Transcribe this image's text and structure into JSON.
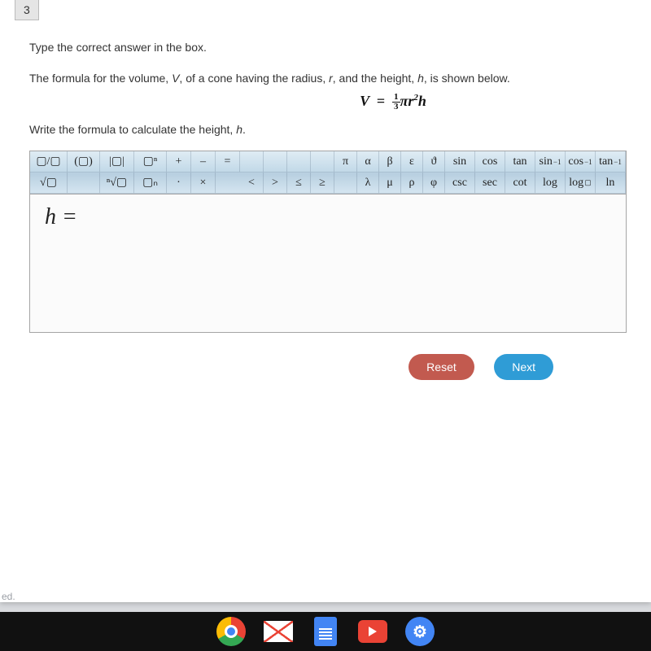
{
  "question_number": "3",
  "instruction": "Type the correct answer in the box.",
  "description_prefix": "The formula for the volume, ",
  "desc_v": "V",
  "description_mid1": ", of a cone having the radius, ",
  "desc_r": "r",
  "description_mid2": ", and the height, ",
  "desc_h": "h",
  "description_suffix": ", is shown below.",
  "formula_latex": "V = \\tfrac{1}{3}\\pi r^{2} h",
  "prompt_prefix": "Write the formula to calculate the height, ",
  "prompt_h": "h",
  "prompt_suffix": ".",
  "answer_prefill": "h  =",
  "buttons": {
    "reset": "Reset",
    "next": "Next"
  },
  "footer_text": "ed.",
  "toolbar": {
    "col1": {
      "r0": "▢/▢",
      "r1": "√▢"
    },
    "col2": {
      "r0": "(▢)",
      "r1": ""
    },
    "col3": {
      "r0": "|▢|",
      "r1": "ⁿ√▢"
    },
    "col4": {
      "r0": "▢ⁿ",
      "r1": "▢ₙ"
    },
    "ops": {
      "plus": "+",
      "minus": "–",
      "eq": "=",
      "dot": "·",
      "times": "×",
      "lt": "<",
      "gt": ">",
      "le": "≤",
      "ge": "≥"
    },
    "pi": "π",
    "greek": {
      "a": "α",
      "b": "β",
      "e": "ε",
      "th": "ϑ",
      "la": "λ",
      "mu": "μ",
      "rho": "ρ",
      "phi": "φ"
    },
    "funcs": {
      "sin": "sin",
      "cos": "cos",
      "tan": "tan",
      "asin": "sin",
      "acos": "cos",
      "atan": "tan",
      "inv": "−1",
      "csc": "csc",
      "sec": "sec",
      "cot": "cot",
      "log": "log",
      "logn": "log",
      "ln": "ln",
      "sub": "▢"
    }
  }
}
